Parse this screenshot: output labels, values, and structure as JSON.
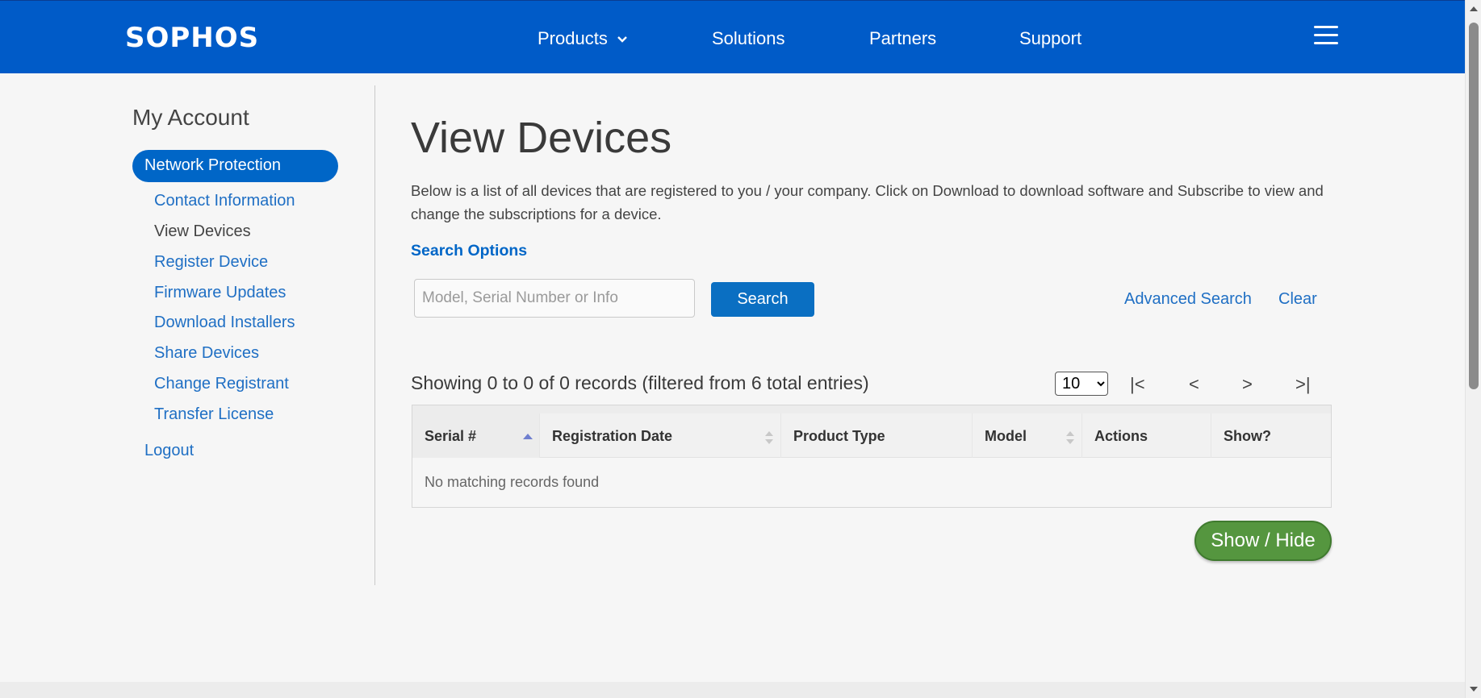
{
  "header": {
    "logo": "SOPHOS",
    "nav": {
      "products": "Products",
      "solutions": "Solutions",
      "partners": "Partners",
      "support": "Support"
    }
  },
  "sidebar": {
    "title": "My Account",
    "active": "Network Protection",
    "items": [
      {
        "label": "Contact Information"
      },
      {
        "label": "View Devices"
      },
      {
        "label": "Register Device"
      },
      {
        "label": "Firmware Updates"
      },
      {
        "label": "Download Installers"
      },
      {
        "label": "Share Devices"
      },
      {
        "label": "Change Registrant"
      },
      {
        "label": "Transfer License"
      }
    ],
    "logout": "Logout"
  },
  "main": {
    "title": "View Devices",
    "intro": "Below is a list of all devices that are registered to you / your company. Click on Download to download software and Subscribe to view and change the subscriptions for a device.",
    "search_options": "Search Options",
    "search": {
      "placeholder": "Model, Serial Number or Info",
      "value": "",
      "button": "Search",
      "advanced": "Advanced Search",
      "clear": "Clear"
    },
    "records_info": "Showing 0 to 0 of 0 records (filtered from 6 total entries)",
    "page_size": "10",
    "pager": {
      "first": "|<",
      "prev": "<",
      "next": ">",
      "last": ">|"
    },
    "table": {
      "columns": [
        "Serial #",
        "Registration Date",
        "Product Type",
        "Model",
        "Actions",
        "Show?"
      ],
      "empty": "No matching records found"
    },
    "show_hide": "Show / Hide"
  },
  "colors": {
    "brand_blue": "#005bc8",
    "link_blue": "#1f6fc4",
    "button_green": "#55963f"
  }
}
